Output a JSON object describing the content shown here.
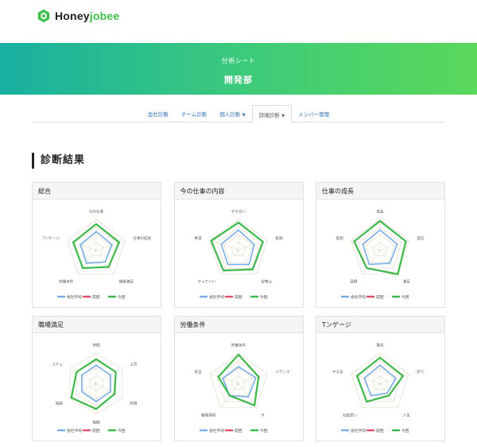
{
  "brand": {
    "name_part1": "Honey",
    "name_part2": "jobee"
  },
  "banner": {
    "subtitle": "分析シート",
    "title": "開発部"
  },
  "tabs": [
    {
      "label": "会社診断",
      "active": false,
      "dropdown": false
    },
    {
      "label": "チーム診断",
      "active": false,
      "dropdown": false
    },
    {
      "label": "個人診断",
      "active": false,
      "dropdown": true
    },
    {
      "label": "詳細診断",
      "active": true,
      "dropdown": true
    },
    {
      "label": "メンバー管理",
      "active": false,
      "dropdown": false
    }
  ],
  "section_title": "診断結果",
  "legend": {
    "company_avg": "会社平均",
    "previous": "前回",
    "current": "今回"
  },
  "colors": {
    "company_avg": "#7aaee8",
    "previous": "#e0506a",
    "current": "#3db84a",
    "grid": "#e2d8c0"
  },
  "charts": [
    {
      "title": "総合",
      "axes": [
        "今の仕事",
        "仕事の成長",
        "職場満足",
        "労働条件",
        "Tンゲージ"
      ],
      "company_avg": [
        0.6,
        0.55,
        0.5,
        0.55,
        0.55
      ],
      "current": [
        0.85,
        0.8,
        0.7,
        0.75,
        0.8
      ]
    },
    {
      "title": "今の仕事の内容",
      "axes": [
        "やりがい",
        "役割",
        "好奇心",
        "やっていい",
        "希望"
      ],
      "company_avg": [
        0.65,
        0.55,
        0.6,
        0.6,
        0.6
      ],
      "current": [
        0.9,
        0.85,
        0.8,
        0.85,
        0.95
      ]
    },
    {
      "title": "仕事の成長",
      "axes": [
        "成長",
        "自信",
        "満足",
        "目標",
        "役割"
      ],
      "company_avg": [
        0.65,
        0.6,
        0.55,
        0.6,
        0.6
      ],
      "current": [
        0.95,
        0.9,
        1.0,
        0.75,
        0.9
      ]
    },
    {
      "title": "職場満足",
      "axes": [
        "仲間",
        "上司",
        "評価",
        "報酬",
        "協調",
        "コミュ"
      ],
      "company_avg": [
        0.6,
        0.55,
        0.55,
        0.6,
        0.55,
        0.55
      ],
      "current": [
        0.8,
        0.75,
        0.7,
        0.85,
        0.95,
        0.75
      ]
    },
    {
      "title": "労働条件",
      "axes": [
        "労働条件",
        "バランス",
        "IT",
        "職場環境",
        "安全"
      ],
      "company_avg": [
        0.55,
        0.6,
        0.55,
        0.5,
        0.55
      ],
      "current": [
        0.95,
        0.7,
        0.9,
        0.5,
        0.7
      ]
    },
    {
      "title": "Tンゲージ",
      "axes": [
        "理念",
        "誇り",
        "人生",
        "社員思い",
        "やる気"
      ],
      "company_avg": [
        0.6,
        0.55,
        0.4,
        0.5,
        0.55
      ],
      "current": [
        0.85,
        0.8,
        0.5,
        0.75,
        0.8
      ]
    }
  ]
}
